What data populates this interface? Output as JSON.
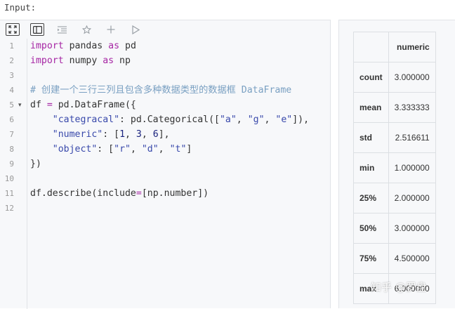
{
  "input_label": "Input:",
  "toolbar": {
    "icons": [
      "fullscreen-icon",
      "split-view-icon",
      "indent-icon",
      "star-icon",
      "add-icon",
      "run-icon"
    ]
  },
  "editor": {
    "line_numbers": [
      "1",
      "2",
      "3",
      "4",
      "5",
      "6",
      "7",
      "8",
      "9",
      "10",
      "11",
      "12"
    ],
    "lines": [
      [
        {
          "t": "import",
          "c": "kw"
        },
        {
          "t": " pandas ",
          "c": ""
        },
        {
          "t": "as",
          "c": "kw"
        },
        {
          "t": " pd",
          "c": ""
        }
      ],
      [
        {
          "t": "import",
          "c": "kw"
        },
        {
          "t": " numpy ",
          "c": ""
        },
        {
          "t": "as",
          "c": "kw"
        },
        {
          "t": " np",
          "c": ""
        }
      ],
      [],
      [
        {
          "t": "# 创建一个三行三列且包含多种数据类型的数据框 DataFrame",
          "c": "cm"
        }
      ],
      [
        {
          "t": "df ",
          "c": ""
        },
        {
          "t": "=",
          "c": "op"
        },
        {
          "t": " pd.DataFrame({",
          "c": ""
        }
      ],
      [
        {
          "t": "    ",
          "c": ""
        },
        {
          "t": "\"categracal\"",
          "c": "str"
        },
        {
          "t": ": pd.Categorical([",
          "c": ""
        },
        {
          "t": "\"a\"",
          "c": "str"
        },
        {
          "t": ", ",
          "c": ""
        },
        {
          "t": "\"g\"",
          "c": "str"
        },
        {
          "t": ", ",
          "c": ""
        },
        {
          "t": "\"e\"",
          "c": "str"
        },
        {
          "t": "]),",
          "c": ""
        }
      ],
      [
        {
          "t": "    ",
          "c": ""
        },
        {
          "t": "\"numeric\"",
          "c": "str"
        },
        {
          "t": ": [",
          "c": ""
        },
        {
          "t": "1",
          "c": "num"
        },
        {
          "t": ", ",
          "c": ""
        },
        {
          "t": "3",
          "c": "num"
        },
        {
          "t": ", ",
          "c": ""
        },
        {
          "t": "6",
          "c": "num"
        },
        {
          "t": "],",
          "c": ""
        }
      ],
      [
        {
          "t": "    ",
          "c": ""
        },
        {
          "t": "\"object\"",
          "c": "str"
        },
        {
          "t": ": [",
          "c": ""
        },
        {
          "t": "\"r\"",
          "c": "str"
        },
        {
          "t": ", ",
          "c": ""
        },
        {
          "t": "\"d\"",
          "c": "str"
        },
        {
          "t": ", ",
          "c": ""
        },
        {
          "t": "\"t\"",
          "c": "str"
        },
        {
          "t": "]",
          "c": ""
        }
      ],
      [
        {
          "t": "})",
          "c": ""
        }
      ],
      [],
      [
        {
          "t": "df.describe(include",
          "c": ""
        },
        {
          "t": "=",
          "c": "op"
        },
        {
          "t": "[np.number])",
          "c": ""
        }
      ],
      []
    ]
  },
  "output": {
    "columns": [
      "",
      "numeric"
    ],
    "rows": [
      {
        "label": "count",
        "value": "3.000000"
      },
      {
        "label": "mean",
        "value": "3.333333"
      },
      {
        "label": "std",
        "value": "2.516611"
      },
      {
        "label": "min",
        "value": "1.000000"
      },
      {
        "label": "25%",
        "value": "2.000000"
      },
      {
        "label": "50%",
        "value": "3.000000"
      },
      {
        "label": "75%",
        "value": "4.500000"
      },
      {
        "label": "max",
        "value": "6.000000"
      }
    ]
  },
  "watermark": "知乎 @罗盘"
}
